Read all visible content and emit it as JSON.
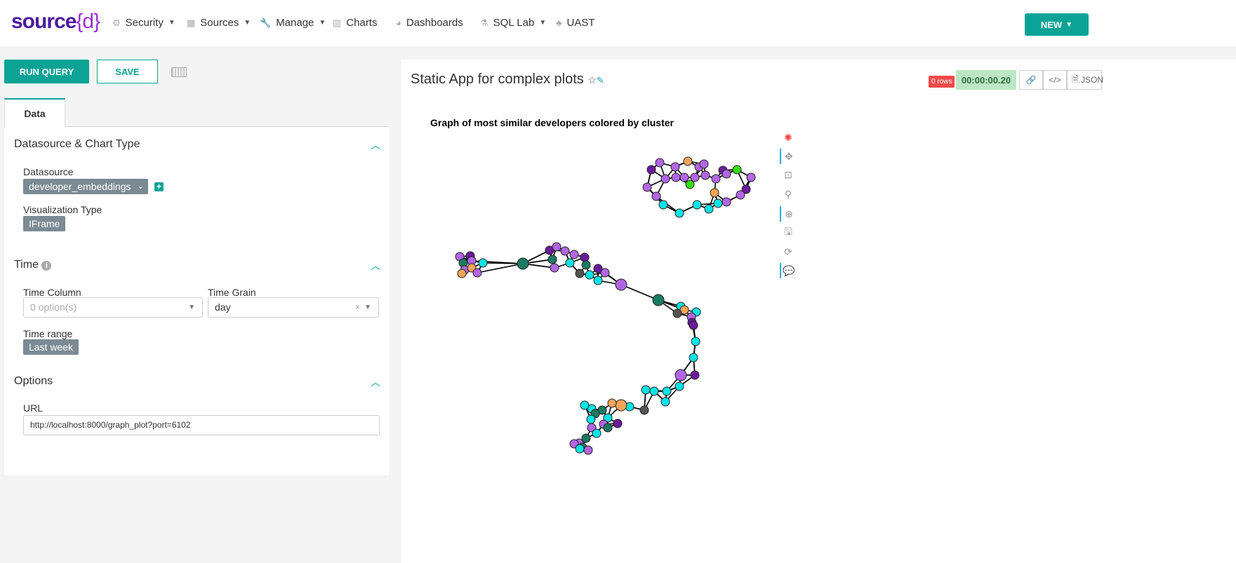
{
  "nav": {
    "logo": "source",
    "logo_brace": "{d}",
    "items": [
      {
        "label": "Security",
        "icon": "gears-icon",
        "dropdown": true
      },
      {
        "label": "Sources",
        "icon": "table-icon",
        "dropdown": true
      },
      {
        "label": "Manage",
        "icon": "wrench-icon",
        "dropdown": true
      },
      {
        "label": "Charts",
        "icon": "bar-chart-icon",
        "dropdown": false
      },
      {
        "label": "Dashboards",
        "icon": "dashboard-icon",
        "dropdown": false
      },
      {
        "label": "SQL Lab",
        "icon": "flask-icon",
        "dropdown": true
      },
      {
        "label": "UAST",
        "icon": "tree-icon",
        "dropdown": false
      }
    ],
    "new_label": "NEW"
  },
  "toolbar": {
    "run": "RUN QUERY",
    "save": "SAVE"
  },
  "tab": "Data",
  "sections": {
    "datasource": {
      "title": "Datasource & Chart Type",
      "datasource_label": "Datasource",
      "datasource_value": "developer_embeddings",
      "viz_label": "Visualization Type",
      "viz_value": "IFrame"
    },
    "time": {
      "title": "Time",
      "column_label": "Time Column",
      "column_placeholder": "0 option(s)",
      "grain_label": "Time Grain",
      "grain_value": "day",
      "range_label": "Time range",
      "range_value": "Last week"
    },
    "options": {
      "title": "Options",
      "url_label": "URL",
      "url_value": "http://localhost:8000/graph_plot?port=6102"
    }
  },
  "chart": {
    "title": "Static App for complex plots",
    "rows": "0 rows",
    "timer": "00:00:00.20",
    "json": ".JSON",
    "graph_title": "Graph of most similar developers colored by cluster"
  },
  "colors": {
    "accent": "#0aa396",
    "lavender": "#b266e6",
    "purple": "#6a1b9a",
    "cyan": "#00e6e6",
    "teal": "#1b7a63",
    "orange": "#f5a55a",
    "green": "#33dd11",
    "gray": "#555555"
  }
}
